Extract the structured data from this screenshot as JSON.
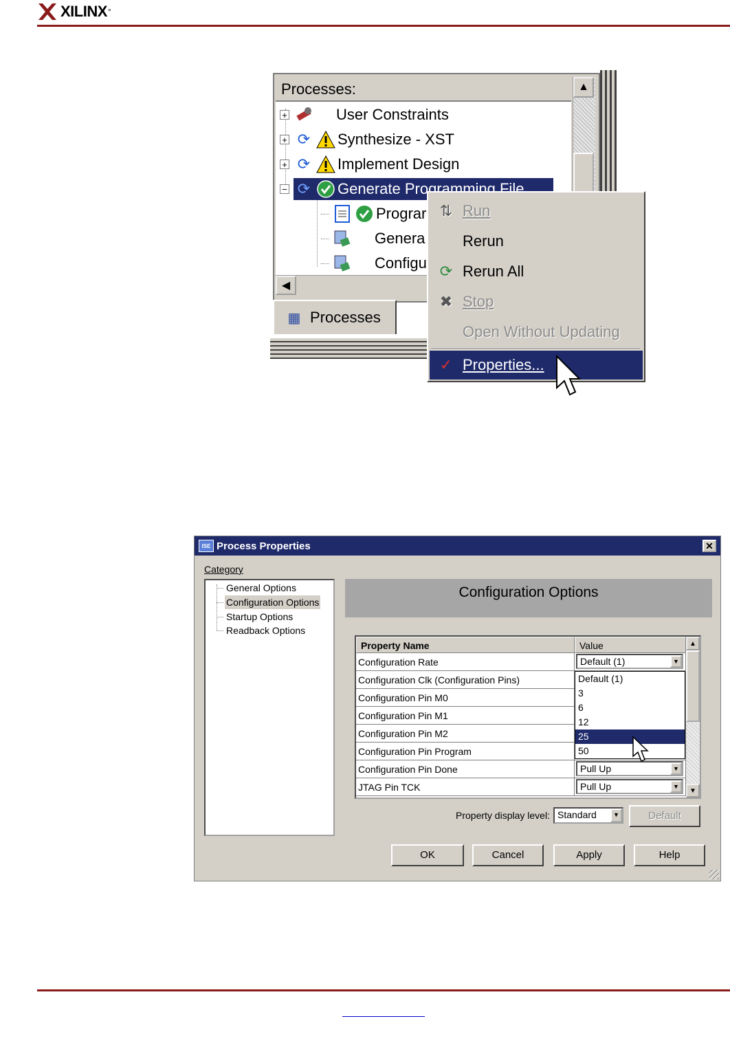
{
  "header": {
    "logo": "XILINX"
  },
  "processes_panel": {
    "header": "Processes:",
    "tree": [
      {
        "label": "User Constraints",
        "expander": "+"
      },
      {
        "label": "Synthesize - XST",
        "expander": "+"
      },
      {
        "label": "Implement Design",
        "expander": "+"
      },
      {
        "label": "Generate Programming File",
        "expander": "−"
      },
      {
        "label": "Prograr"
      },
      {
        "label": "Genera"
      },
      {
        "label": "Configu"
      }
    ],
    "tab_label": "Processes"
  },
  "context_menu": {
    "items": [
      {
        "label": "Run",
        "enabled": false
      },
      {
        "label": "Rerun",
        "enabled": true
      },
      {
        "label": "Rerun All",
        "enabled": true
      },
      {
        "label": "Stop",
        "enabled": false
      },
      {
        "label": "Open Without Updating",
        "enabled": false
      },
      {
        "label": "Properties...",
        "enabled": true,
        "highlighted": true
      }
    ]
  },
  "dialog": {
    "title": "Process Properties",
    "close_glyph": "✕",
    "category_label": "Category",
    "categories": [
      "General Options",
      "Configuration Options",
      "Startup Options",
      "Readback Options"
    ],
    "selected_category": "Configuration Options",
    "banner": "Configuration Options",
    "grid": {
      "headers": [
        "Property Name",
        "Value"
      ],
      "rows": [
        {
          "name": "Configuration Rate",
          "value": "Default (1)"
        },
        {
          "name": "Configuration Clk (Configuration Pins)",
          "value": ""
        },
        {
          "name": "Configuration Pin M0",
          "value": ""
        },
        {
          "name": "Configuration Pin M1",
          "value": ""
        },
        {
          "name": "Configuration Pin M2",
          "value": ""
        },
        {
          "name": "Configuration Pin Program",
          "value": ""
        },
        {
          "name": "Configuration Pin Done",
          "value": "Pull Up"
        },
        {
          "name": "JTAG Pin TCK",
          "value": "Pull Up"
        }
      ]
    },
    "dropdown_options": [
      "Default (1)",
      "3",
      "6",
      "12",
      "25",
      "50"
    ],
    "dropdown_highlighted": "25",
    "property_display_level_label": "Property display level:",
    "property_display_level_value": "Standard",
    "buttons": {
      "default": "Default",
      "ok": "OK",
      "cancel": "Cancel",
      "apply": "Apply",
      "help": "Help"
    }
  },
  "colors": {
    "accent_rule": "#8a1b1b",
    "selection": "#1f2a6b",
    "face": "#d4d0c8"
  }
}
